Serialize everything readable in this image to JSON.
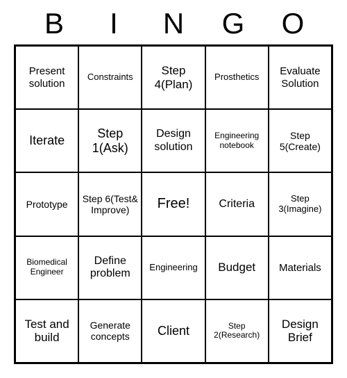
{
  "header": [
    "B",
    "I",
    "N",
    "G",
    "O"
  ],
  "cells": [
    {
      "text": "Present solution",
      "size": "fs-15"
    },
    {
      "text": "Constraints",
      "size": "fs-13"
    },
    {
      "text": "Step 4(Plan)",
      "size": "fs-17"
    },
    {
      "text": "Prosthetics",
      "size": "fs-13"
    },
    {
      "text": "Evaluate Solution",
      "size": "fs-15"
    },
    {
      "text": "Iterate",
      "size": "fs-18"
    },
    {
      "text": "Step 1(Ask)",
      "size": "fs-18"
    },
    {
      "text": "Design solution",
      "size": "fs-16"
    },
    {
      "text": "Engineering notebook",
      "size": "fs-12"
    },
    {
      "text": "Step 5(Create)",
      "size": "fs-14"
    },
    {
      "text": "Prototype",
      "size": "fs-14"
    },
    {
      "text": "Step 6(Test& Improve)",
      "size": "fs-14"
    },
    {
      "text": "Free!",
      "size": "free"
    },
    {
      "text": "Criteria",
      "size": "fs-16"
    },
    {
      "text": "Step 3(Imagine)",
      "size": "fs-13"
    },
    {
      "text": "Biomedical Engineer",
      "size": "fs-12"
    },
    {
      "text": "Define problem",
      "size": "fs-16"
    },
    {
      "text": "Engineering",
      "size": "fs-13"
    },
    {
      "text": "Budget",
      "size": "fs-17"
    },
    {
      "text": "Materials",
      "size": "fs-15"
    },
    {
      "text": "Test and build",
      "size": "fs-17"
    },
    {
      "text": "Generate concepts",
      "size": "fs-14"
    },
    {
      "text": "Client",
      "size": "fs-18"
    },
    {
      "text": "Step 2(Research)",
      "size": "fs-12"
    },
    {
      "text": "Design Brief",
      "size": "fs-17"
    }
  ]
}
